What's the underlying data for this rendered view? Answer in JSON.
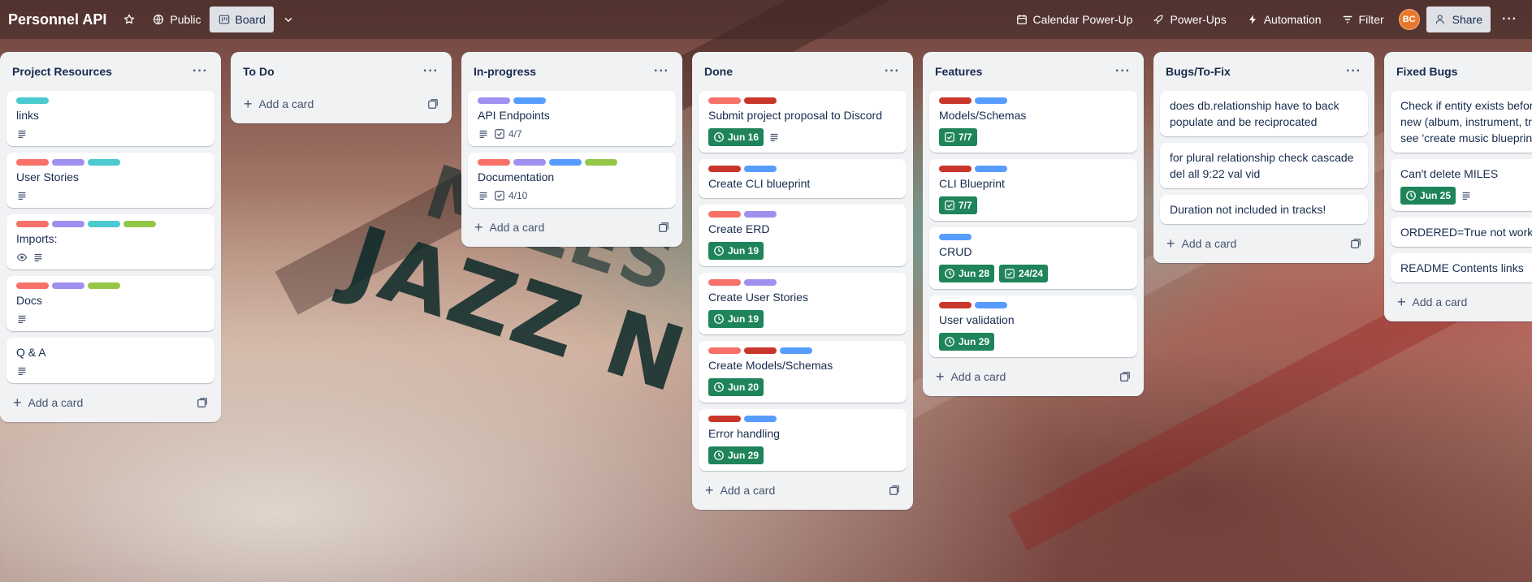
{
  "board": {
    "title": "Personnel API",
    "visibility": "Public",
    "view": "Board"
  },
  "topbar": {
    "calendar": "Calendar Power-Up",
    "powerups": "Power-Ups",
    "automation": "Automation",
    "filter": "Filter",
    "avatar_initials": "BC",
    "share": "Share"
  },
  "colors": {
    "teal": "#4bcad0",
    "salmon": "#f87168",
    "purple": "#9f8fef",
    "blue": "#579dff",
    "green": "#94c748",
    "red": "#c9372c",
    "date_green": "#1f845a"
  },
  "add_card_label": "Add a card",
  "lists": [
    {
      "title": "Project Resources",
      "cards": [
        {
          "title": "links",
          "labels": [
            "teal"
          ],
          "badges": [
            {
              "type": "description"
            }
          ]
        },
        {
          "title": "User Stories",
          "labels": [
            "salmon",
            "purple",
            "teal"
          ],
          "badges": [
            {
              "type": "description"
            }
          ]
        },
        {
          "title": "Imports:",
          "labels": [
            "salmon",
            "purple",
            "teal",
            "green"
          ],
          "badges": [
            {
              "type": "watch"
            },
            {
              "type": "description"
            }
          ]
        },
        {
          "title": "Docs",
          "labels": [
            "salmon",
            "purple",
            "green"
          ],
          "badges": [
            {
              "type": "description"
            }
          ]
        },
        {
          "title": "Q & A",
          "labels": [],
          "badges": [
            {
              "type": "description"
            }
          ]
        }
      ]
    },
    {
      "title": "To Do",
      "cards": []
    },
    {
      "title": "In-progress",
      "cards": [
        {
          "title": "API Endpoints",
          "labels": [
            "purple",
            "blue"
          ],
          "badges": [
            {
              "type": "description"
            },
            {
              "type": "checklist",
              "text": "4/7"
            }
          ]
        },
        {
          "title": "Documentation",
          "labels": [
            "salmon",
            "purple",
            "blue",
            "green"
          ],
          "badges": [
            {
              "type": "description"
            },
            {
              "type": "checklist",
              "text": "4/10"
            }
          ]
        }
      ]
    },
    {
      "title": "Done",
      "cards": [
        {
          "title": "Submit project proposal to Discord",
          "labels": [
            "salmon",
            "red"
          ],
          "badges": [
            {
              "type": "date",
              "text": "Jun 16"
            },
            {
              "type": "description"
            }
          ]
        },
        {
          "title": "Create CLI blueprint",
          "labels": [
            "red",
            "blue"
          ],
          "badges": []
        },
        {
          "title": "Create ERD",
          "labels": [
            "salmon",
            "purple"
          ],
          "badges": [
            {
              "type": "date",
              "text": "Jun 19"
            }
          ]
        },
        {
          "title": "Create User Stories",
          "labels": [
            "salmon",
            "purple"
          ],
          "badges": [
            {
              "type": "date",
              "text": "Jun 19"
            }
          ]
        },
        {
          "title": "Create Models/Schemas",
          "labels": [
            "salmon",
            "red",
            "blue"
          ],
          "badges": [
            {
              "type": "date",
              "text": "Jun 20"
            }
          ]
        },
        {
          "title": "Error handling",
          "labels": [
            "red",
            "blue"
          ],
          "badges": [
            {
              "type": "date",
              "text": "Jun 29"
            }
          ]
        }
      ]
    },
    {
      "title": "Features",
      "cards": [
        {
          "title": "Models/Schemas",
          "labels": [
            "red",
            "blue"
          ],
          "badges": [
            {
              "type": "checkgreen",
              "text": "7/7"
            }
          ]
        },
        {
          "title": "CLI Blueprint",
          "labels": [
            "red",
            "blue"
          ],
          "badges": [
            {
              "type": "checkgreen",
              "text": "7/7"
            }
          ]
        },
        {
          "title": "CRUD",
          "labels": [
            "blue"
          ],
          "badges": [
            {
              "type": "date",
              "text": "Jun 28"
            },
            {
              "type": "checkgreen",
              "text": "24/24"
            }
          ]
        },
        {
          "title": "User validation",
          "labels": [
            "red",
            "blue"
          ],
          "badges": [
            {
              "type": "date",
              "text": "Jun 29"
            }
          ]
        }
      ]
    },
    {
      "title": "Bugs/To-Fix",
      "cards": [
        {
          "title": "does db.relationship have to back populate and be reciprocated",
          "labels": [],
          "badges": []
        },
        {
          "title": "for plural relationship check cascade del all 9:22 val vid",
          "labels": [],
          "badges": []
        },
        {
          "title": "Duration not included in tracks!",
          "labels": [],
          "badges": []
        }
      ]
    },
    {
      "title": "Fixed Bugs",
      "cards": [
        {
          "title": "Check if entity exists before creating new (album, instrument, track, etc. see 'create music blueprint)",
          "labels": [],
          "badges": []
        },
        {
          "title": "Can't delete MILES",
          "labels": [],
          "badges": [
            {
              "type": "date",
              "text": "Jun 25"
            },
            {
              "type": "description"
            }
          ]
        },
        {
          "title": "ORDERED=True not working",
          "labels": [],
          "badges": []
        },
        {
          "title": "README Contents links",
          "labels": [],
          "badges": []
        }
      ]
    }
  ]
}
